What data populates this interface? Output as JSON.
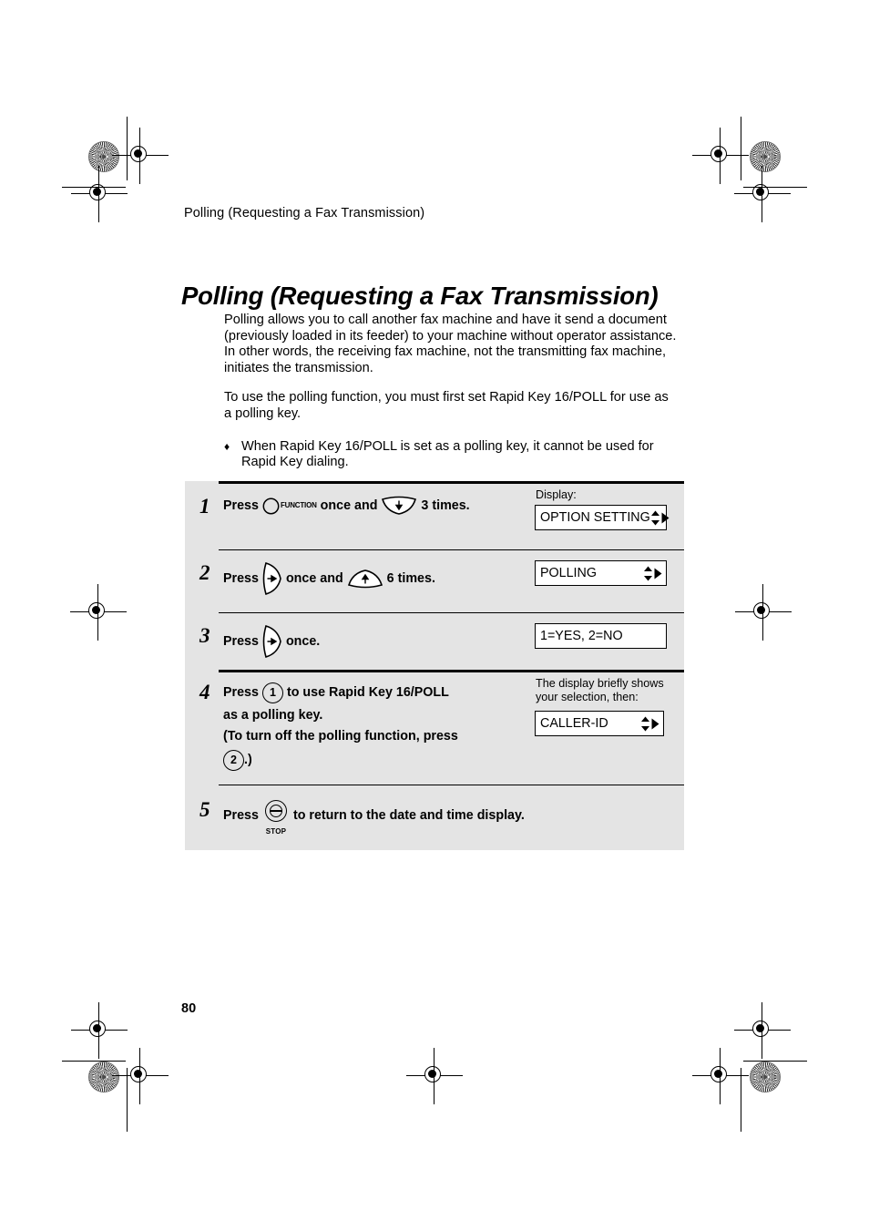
{
  "document": {
    "running_head": "Polling (Requesting a Fax Transmission)",
    "title": "Polling (Requesting a Fax Transmission)",
    "page_number": "80"
  },
  "intro": {
    "paragraph_1": "Polling allows you to call another fax machine and have it send a document (previously loaded in its feeder) to your machine without operator assistance. In other words, the receiving fax machine, not the transmitting fax machine, initiates the transmission.",
    "paragraph_2": "To use the polling function, you must first set Rapid Key 16/POLL for use as a polling key.",
    "bullet_glyph": "♦",
    "bullet_1": "When Rapid Key 16/POLL is set as a polling key, it cannot be used for Rapid Key dialing."
  },
  "steps": [
    {
      "number": "1",
      "press_word": "Press",
      "function_key_label": "FUNCTION",
      "mid_text": "once and",
      "tail_text": "3 times.",
      "display_caption": "Display:",
      "display_text": "OPTION SETTING",
      "display_arrows": "updown-right"
    },
    {
      "number": "2",
      "press_word": "Press",
      "mid_text": "once and",
      "tail_text": "6 times.",
      "display_text": "POLLING",
      "display_arrows": "updown-right"
    },
    {
      "number": "3",
      "press_word": "Press",
      "tail_text": "once.",
      "display_text": "1=YES, 2=NO",
      "display_arrows": "none"
    },
    {
      "number": "4",
      "press_word": "Press",
      "key_1": "1",
      "line_1_tail": "to use Rapid Key 16/POLL",
      "line_2": "as a polling key.",
      "line_3": "(To turn off the polling function, press",
      "key_2": "2",
      "line_4_tail": ".)",
      "display_caption": "The display briefly shows your selection, then:",
      "display_text": "CALLER-ID",
      "display_arrows": "updown-right"
    },
    {
      "number": "5",
      "press_word": "Press",
      "stop_key_label": "STOP",
      "tail_text": "to return to the date and time display."
    }
  ],
  "colors": {
    "panel_background": "#e4e4e4",
    "page_background": "#ffffff",
    "ink": "#000000",
    "display_background": "#ffffff"
  }
}
